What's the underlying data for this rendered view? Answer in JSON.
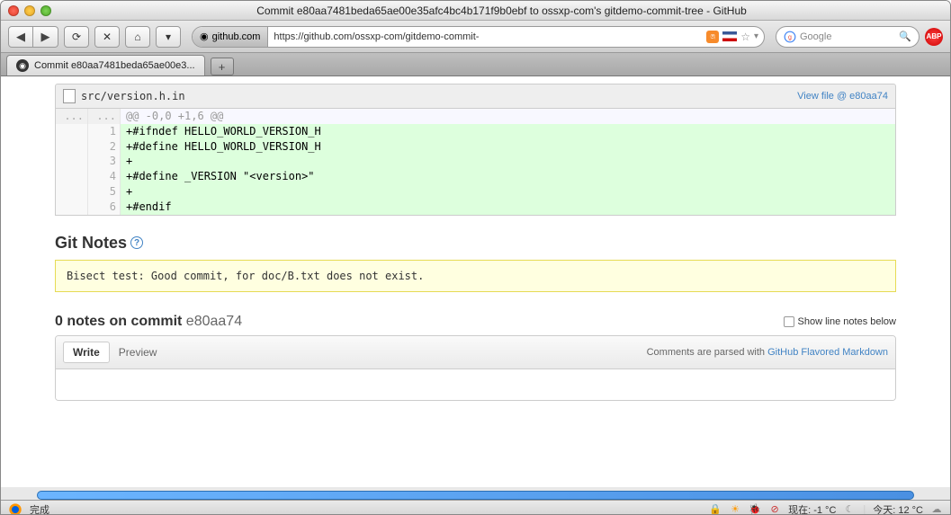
{
  "window": {
    "title": "Commit e80aa7481beda65ae00e35afc4bc4b171f9b0ebf to ossxp-com's gitdemo-commit-tree - GitHub"
  },
  "url": {
    "domain": "github.com",
    "full": "https://github.com/ossxp-com/gitdemo-commit-"
  },
  "search": {
    "placeholder": "Google"
  },
  "tab": {
    "label": "Commit e80aa7481beda65ae00e3..."
  },
  "file": {
    "name": "src/version.h.in",
    "view_link": "View file @ e80aa74"
  },
  "diff": {
    "hunk": "@@ -0,0 +1,6 @@",
    "lines": [
      {
        "n": "1",
        "text": "+#ifndef HELLO_WORLD_VERSION_H"
      },
      {
        "n": "2",
        "text": "+#define HELLO_WORLD_VERSION_H"
      },
      {
        "n": "3",
        "text": "+"
      },
      {
        "n": "4",
        "text": "+#define _VERSION \"<version>\""
      },
      {
        "n": "5",
        "text": "+"
      },
      {
        "n": "6",
        "text": "+#endif"
      }
    ]
  },
  "gitnotes": {
    "heading": "Git Notes",
    "content": "Bisect test: Good commit, for doc/B.txt does not exist."
  },
  "notes": {
    "count_prefix": "0 notes on commit ",
    "hash": "e80aa74",
    "show_label": "Show line notes below"
  },
  "comment": {
    "write": "Write",
    "preview": "Preview",
    "parsed_prefix": "Comments are parsed with ",
    "parsed_link": "GitHub Flavored Markdown"
  },
  "status": {
    "done": "完成",
    "now_label": "现在: -1 °C",
    "today_label": "今天: 12 °C"
  }
}
